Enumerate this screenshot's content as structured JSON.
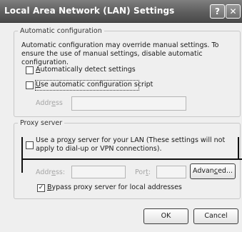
{
  "window": {
    "title": "Local Area Network (LAN) Settings",
    "help_glyph": "?",
    "close_glyph": "✕"
  },
  "auto_config": {
    "legend": "Automatic configuration",
    "description": "Automatic configuration may override manual settings.  To ensure the use of manual settings, disable automatic configuration.",
    "auto_detect": {
      "pre": "",
      "key": "A",
      "post": "utomatically detect settings",
      "checked": false
    },
    "use_script": {
      "pre": "",
      "key": "U",
      "post": "se automatic configuration script",
      "checked": false
    },
    "address": {
      "pre": "Addr",
      "key": "e",
      "post": "ss",
      "value": ""
    }
  },
  "proxy": {
    "legend": "Proxy server",
    "use_proxy": {
      "pre": "Use a pro",
      "key": "x",
      "post": "y server for your LAN (These settings will not apply to dial-up or VPN connections).",
      "checked": false
    },
    "address": {
      "pre": "Addr",
      "key": "e",
      "post": "ss:",
      "value": ""
    },
    "port": {
      "pre": "Por",
      "key": "t",
      "post": ":",
      "value": ""
    },
    "advanced": {
      "pre": "Advan",
      "key": "c",
      "post": "ed..."
    },
    "bypass": {
      "pre": "",
      "key": "B",
      "post": "ypass proxy server for local addresses",
      "checked": true,
      "mark": "✓"
    }
  },
  "buttons": {
    "ok": "OK",
    "cancel": "Cancel"
  }
}
